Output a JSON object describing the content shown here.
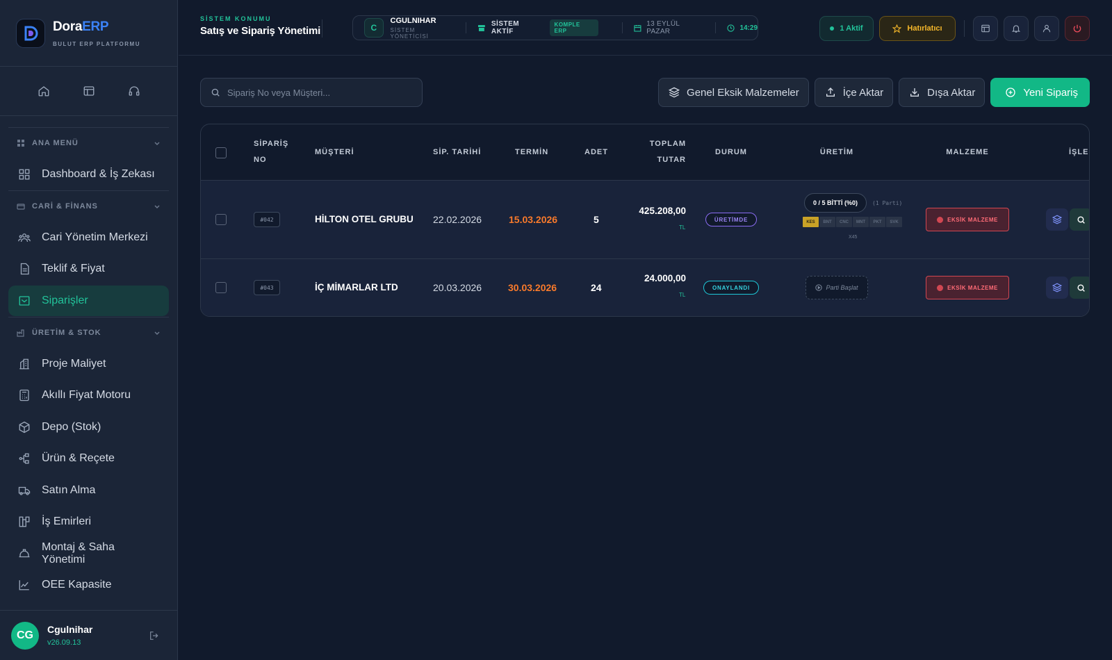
{
  "brand": {
    "name_main": "Dora",
    "name_accent": "ERP",
    "subtitle": "BULUT ERP PLATFORMU"
  },
  "sidebar": {
    "sections": [
      {
        "label": "ANA MENÜ",
        "items": [
          {
            "label": "Dashboard & İş Zekası",
            "icon": "dashboard-icon"
          }
        ]
      },
      {
        "label": "CARİ & FİNANS",
        "items": [
          {
            "label": "Cari Yönetim Merkezi",
            "icon": "users-icon"
          },
          {
            "label": "Teklif & Fiyat",
            "icon": "document-icon"
          },
          {
            "label": "Siparişler",
            "icon": "orders-icon",
            "active": true
          }
        ]
      },
      {
        "label": "ÜRETİM & STOK",
        "items": [
          {
            "label": "Proje Maliyet",
            "icon": "building-icon"
          },
          {
            "label": "Akıllı Fiyat Motoru",
            "icon": "calculator-icon"
          },
          {
            "label": "Depo (Stok)",
            "icon": "box-icon"
          },
          {
            "label": "Ürün & Reçete",
            "icon": "workflow-icon"
          },
          {
            "label": "Satın Alma",
            "icon": "truck-icon"
          },
          {
            "label": "İş Emirleri",
            "icon": "work-order-icon"
          },
          {
            "label": "Montaj & Saha Yönetimi",
            "icon": "helmet-icon"
          },
          {
            "label": "OEE Kapasite",
            "icon": "chart-icon"
          }
        ]
      }
    ],
    "user": {
      "initials": "CG",
      "name": "Cgulnihar",
      "version": "v26.09.13"
    }
  },
  "header": {
    "location_label": "SİSTEM KONUMU",
    "location_title": "Satış ve Sipariş Yönetimi",
    "user_initial": "C",
    "user_name": "CGULNIHAR",
    "user_role": "SİSTEM YÖNETİCİSİ",
    "system_status": "SİSTEM AKTİF",
    "plan_badge": "KOMPLE ERP",
    "date": "13 EYLÜL PAZAR",
    "time": "14:29",
    "active_count": "1 Aktif",
    "reminder": "Hatırlatıcı"
  },
  "toolbar": {
    "search_placeholder": "Sipariş No veya Müşteri...",
    "btn_missing": "Genel Eksik Malzemeler",
    "btn_import": "İçe Aktar",
    "btn_export": "Dışa Aktar",
    "btn_new": "Yeni Sipariş"
  },
  "table": {
    "headers": {
      "sip_no_1": "SİPARİŞ",
      "sip_no_2": "NO",
      "customer": "MÜŞTERİ",
      "order_date": "SİP. TARİHİ",
      "deadline": "TERMİN",
      "qty": "ADET",
      "total_1": "TOPLAM",
      "total_2": "TUTAR",
      "status": "DURUM",
      "production": "ÜRETİM",
      "material": "MALZEME",
      "actions": "İŞLEM"
    },
    "rows": [
      {
        "no": "#042",
        "customer": "HİLTON OTEL GRUBU",
        "order_date": "22.02.2026",
        "deadline": "15.03.2026",
        "qty": "5",
        "total": "425.208,00",
        "currency": "TL",
        "status": "ÜRETİMDE",
        "progress": "0 / 5 BİTTİ (%0)",
        "batch": "(1 Parti)",
        "stages": [
          "KES",
          "BNT",
          "CNC",
          "MNT",
          "PKT",
          "SVK"
        ],
        "multiplier": "X45",
        "material": "EKSİK MALZEME"
      },
      {
        "no": "#043",
        "customer": "İÇ MİMARLAR LTD",
        "order_date": "20.03.2026",
        "deadline": "30.03.2026",
        "qty": "24",
        "total": "24.000,00",
        "currency": "TL",
        "status": "ONAYLANDI",
        "start_batch": "Parti Başlat",
        "material": "EKSİK MALZEME"
      }
    ]
  },
  "colors": {
    "accent": "#22c39a",
    "warning": "#f97a2b",
    "danger": "#d14752",
    "background": "#111a2c"
  }
}
